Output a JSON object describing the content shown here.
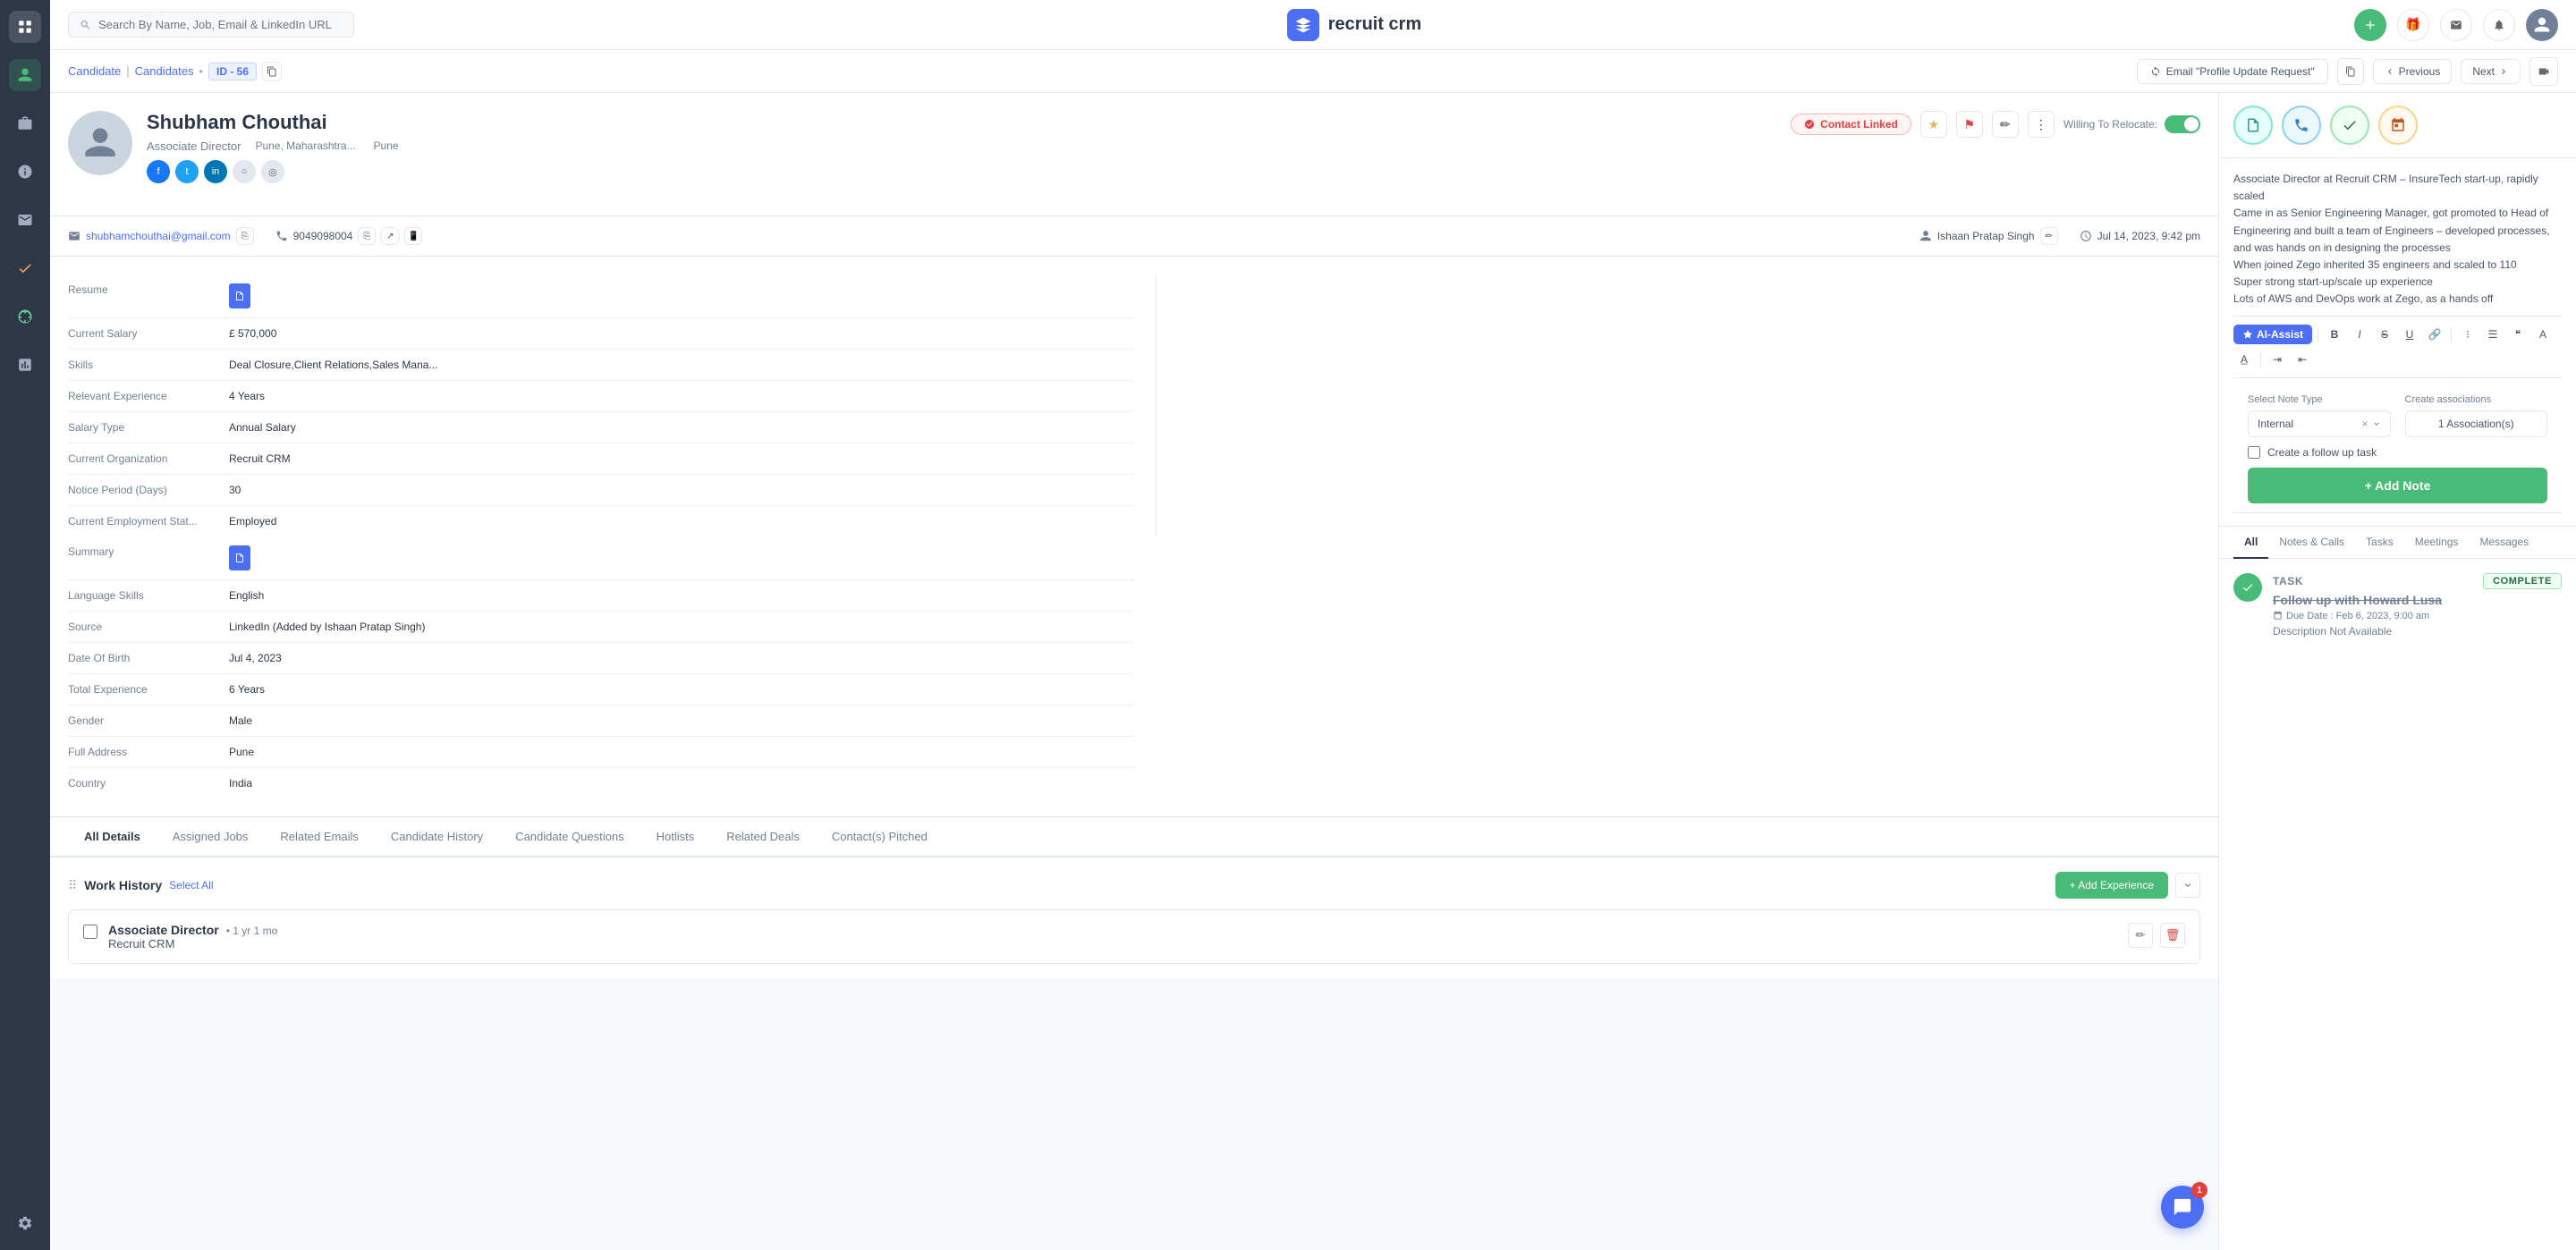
{
  "app": {
    "name": "recruit crm",
    "search_placeholder": "Search By Name, Job, Email & LinkedIn URL"
  },
  "breadcrumb": {
    "parent": "Candidate",
    "section": "Candidates",
    "id": "ID - 56"
  },
  "header_actions": {
    "email_btn": "Email \"Profile Update Request\"",
    "previous": "Previous",
    "next": "Next"
  },
  "profile": {
    "name": "Shubham Chouthai",
    "title": "Associate Director",
    "location": "Pune, Maharashtra...",
    "city": "Pune",
    "willing_to_relocate": "Willing To Relocate:",
    "contact_linked_label": "Contact Linked",
    "email": "shubhamchouthai@gmail.com",
    "phone": "9049098004",
    "owner": "Ishaan Pratap Singh",
    "timestamp": "Jul 14, 2023, 9:42 pm"
  },
  "details": {
    "left": [
      {
        "label": "Resume",
        "value": ""
      },
      {
        "label": "Current Salary",
        "value": "£ 570,000"
      },
      {
        "label": "Skills",
        "value": "Deal Closure,Client Relations,Sales Mana..."
      },
      {
        "label": "Relevant Experience",
        "value": "4 Years"
      },
      {
        "label": "Salary Type",
        "value": "Annual Salary"
      },
      {
        "label": "Current Organization",
        "value": "Recruit CRM"
      },
      {
        "label": "Notice Period (Days)",
        "value": "30"
      },
      {
        "label": "Current Employment Stat...",
        "value": "Employed"
      }
    ],
    "right": [
      {
        "label": "Summary",
        "value": ""
      },
      {
        "label": "Language Skills",
        "value": "English"
      },
      {
        "label": "Source",
        "value": "LinkedIn (Added by Ishaan Pratap Singh)"
      },
      {
        "label": "Date Of Birth",
        "value": "Jul 4, 2023"
      },
      {
        "label": "Total Experience",
        "value": "6 Years"
      },
      {
        "label": "Gender",
        "value": "Male"
      },
      {
        "label": "Full Address",
        "value": "Pune"
      },
      {
        "label": "Country",
        "value": "India"
      }
    ]
  },
  "tabs": [
    {
      "id": "all-details",
      "label": "All Details",
      "active": true
    },
    {
      "id": "assigned-jobs",
      "label": "Assigned Jobs"
    },
    {
      "id": "related-emails",
      "label": "Related Emails"
    },
    {
      "id": "candidate-history",
      "label": "Candidate History"
    },
    {
      "id": "candidate-questions",
      "label": "Candidate Questions"
    },
    {
      "id": "hotlists",
      "label": "Hotlists"
    },
    {
      "id": "related-deals",
      "label": "Related Deals"
    },
    {
      "id": "contacts-pitched",
      "label": "Contact(s) Pitched"
    }
  ],
  "work_history": {
    "title": "Work History",
    "select_all": "Select All",
    "add_btn": "+ Add Experience",
    "items": [
      {
        "job_title": "Associate Director",
        "duration": "1 yr 1 mo",
        "company": "Recruit CRM"
      }
    ]
  },
  "right_panel": {
    "note_text_lines": [
      "Associate Director at Recruit CRM – InsureTech start-up, rapidly scaled",
      "Came in as Senior Engineering Manager, got promoted to Head of Engineering and built a team of Engineers – developed processes, and was hands on in designing the processes",
      "When joined Zego inherited 35 engineers and scaled to 110",
      "Super strong start-up/scale up experience",
      "Lots of AWS and DevOps work at Zego, as a hands off"
    ],
    "ai_assist_btn": "AI-Assist",
    "note_type_label": "Select Note Type",
    "associations_label": "Create associations",
    "note_type_value": "Internal",
    "associations_value": "1 Association(s)",
    "follow_up_label": "Create a follow up task",
    "add_note_btn": "+ Add Note"
  },
  "activity_tabs": [
    {
      "id": "all",
      "label": "All",
      "active": true
    },
    {
      "id": "notes-calls",
      "label": "Notes & Calls"
    },
    {
      "id": "tasks",
      "label": "Tasks"
    },
    {
      "id": "meetings",
      "label": "Meetings"
    },
    {
      "id": "messages",
      "label": "Messages"
    }
  ],
  "activity_feed": {
    "items": [
      {
        "type": "TASK",
        "status": "Complete",
        "title": "Follow up with Howard Lusa",
        "due": "Due Date : Feb 6, 2023, 9:00 am",
        "description": "Description Not Available"
      }
    ]
  },
  "chat_badge": "1"
}
